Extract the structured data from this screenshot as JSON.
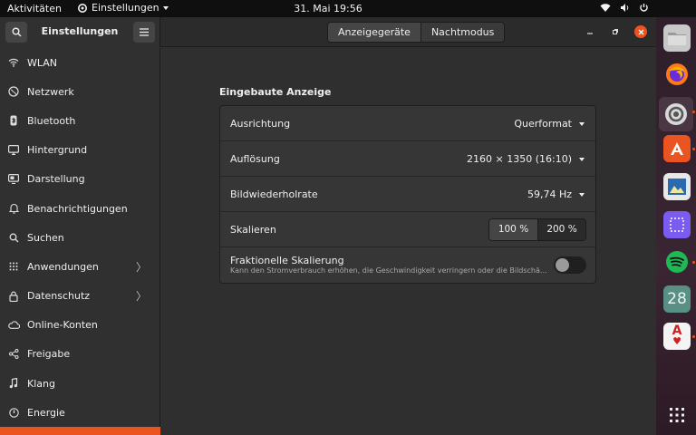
{
  "topbar": {
    "activities": "Aktivitäten",
    "app_menu": "Einstellungen",
    "clock": "31. Mai  19:56"
  },
  "headerbar": {
    "title": "Einstellungen",
    "tabs": [
      {
        "label": "Anzeigegeräte",
        "active": true
      },
      {
        "label": "Nachtmodus",
        "active": false
      }
    ]
  },
  "sidebar": {
    "items": [
      {
        "label": "WLAN",
        "icon": "wifi-icon"
      },
      {
        "label": "Netzwerk",
        "icon": "network-icon"
      },
      {
        "label": "Bluetooth",
        "icon": "bluetooth-icon"
      },
      {
        "label": "Hintergrund",
        "icon": "background-icon"
      },
      {
        "label": "Darstellung",
        "icon": "appearance-icon"
      },
      {
        "label": "Benachrichtigungen",
        "icon": "bell-icon"
      },
      {
        "label": "Suchen",
        "icon": "search-icon"
      },
      {
        "label": "Anwendungen",
        "icon": "apps-grid-icon",
        "chevron": true
      },
      {
        "label": "Datenschutz",
        "icon": "lock-icon",
        "chevron": true
      },
      {
        "label": "Online-Konten",
        "icon": "cloud-icon"
      },
      {
        "label": "Freigabe",
        "icon": "share-icon"
      },
      {
        "label": "Klang",
        "icon": "music-note-icon"
      },
      {
        "label": "Energie",
        "icon": "power-icon"
      }
    ]
  },
  "display": {
    "section_title": "Eingebaute Anzeige",
    "orientation": {
      "label": "Ausrichtung",
      "value": "Querformat"
    },
    "resolution": {
      "label": "Auflösung",
      "value": "2160 × 1350 (16:10)"
    },
    "refresh": {
      "label": "Bildwiederholrate",
      "value": "59,74 Hz"
    },
    "scale": {
      "label": "Skalieren",
      "options": [
        "100 %",
        "200 %"
      ],
      "selected": "100 %"
    },
    "fractional": {
      "label": "Fraktionelle Skalierung",
      "description": "Kann den Stromverbrauch erhöhen, die Geschwindigkeit verringern oder die Bildschärfe verringern.",
      "enabled": false
    }
  },
  "dock": {
    "apps": [
      "files-icon",
      "firefox-icon",
      "settings-icon",
      "software-store-icon",
      "image-viewer-icon",
      "screenshot-icon",
      "spotify-icon",
      "calendar-icon",
      "solitaire-icon"
    ],
    "calendar_day": "28",
    "card": "A"
  },
  "colors": {
    "accent": "#e95420"
  }
}
